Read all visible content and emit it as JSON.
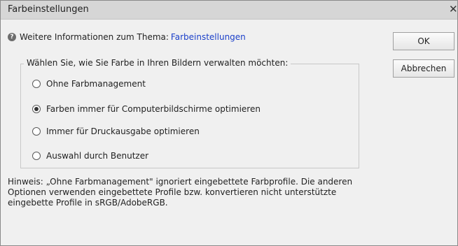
{
  "window": {
    "title": "Farbeinstellungen",
    "close_symbol": "✕"
  },
  "info": {
    "icon": "help-icon",
    "text": "Weitere Informationen zum Thema:",
    "link": "Farbeinstellungen"
  },
  "group": {
    "legend": "Wählen Sie, wie Sie Farbe in Ihren Bildern verwalten möchten:",
    "options": [
      {
        "label": "Ohne Farbmanagement",
        "selected": false
      },
      {
        "label": "Farben immer für Computerbildschirme optimieren",
        "selected": true
      },
      {
        "label": "Immer für Druckausgabe optimieren",
        "selected": false
      },
      {
        "label": "Auswahl durch Benutzer",
        "selected": false
      }
    ]
  },
  "buttons": {
    "ok": "OK",
    "cancel": "Abbrechen"
  },
  "hint": {
    "lines": [
      "Hinweis: „Ohne Farbmanagement\" ignoriert eingebettete Farbprofile. Die anderen",
      "Optionen verwenden eingebettete Profile bzw. konvertieren nicht unterstützte",
      "eingebette Profile in sRGB/AdobeRGB."
    ]
  }
}
